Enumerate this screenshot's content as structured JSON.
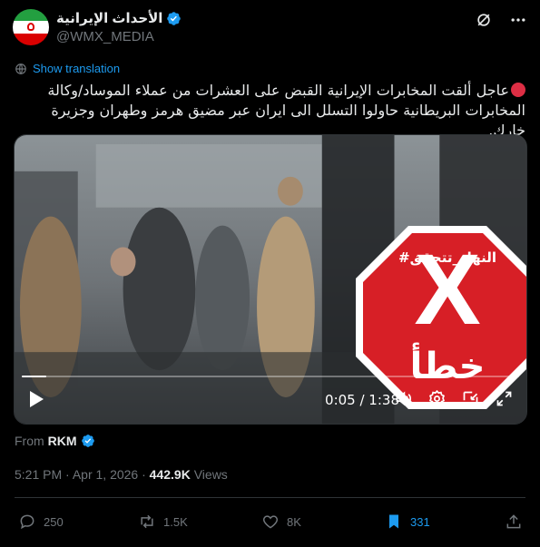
{
  "account": {
    "name": "الأحداث الإيرانية",
    "handle": "@WMX_MEDIA"
  },
  "show_translation": "Show translation",
  "tweet": {
    "line1": "عاجل ألقت المخابرات الإيرانية القبض على العشرات من عملاء الموساد/وكالة",
    "line2": "المخابرات البريطانية حاولوا التسلل الى ايران عبر مضيق هرمز وطهران وجزيرة خارك."
  },
  "video": {
    "time": "0:05 / 1:38",
    "progress_fraction": 0.05
  },
  "stamp": {
    "tag": "#النهار_تتحقق",
    "word": "خطأ"
  },
  "from": {
    "label": "From",
    "source": "RKM"
  },
  "meta": {
    "time": "5:21 PM",
    "dot1": "·",
    "date": "Apr 1, 2026",
    "dot2": "·",
    "views_count": "442.9K",
    "views_label": "Views"
  },
  "actions": {
    "replies": "250",
    "reposts": "1.5K",
    "likes": "8K",
    "bookmarks": "331"
  },
  "colors": {
    "accent": "#1d9bf0",
    "muted": "#71767b",
    "stamp_red": "#d71f26"
  }
}
